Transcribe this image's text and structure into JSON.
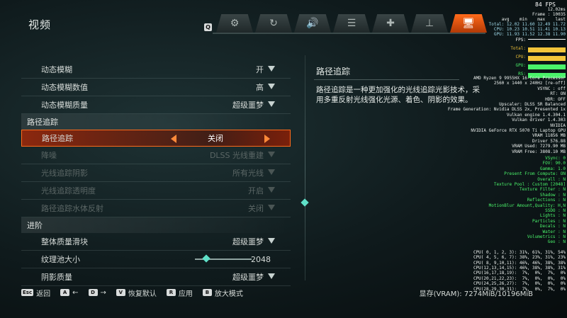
{
  "header": {
    "title": "视频",
    "q_key": "Q",
    "tabs": [
      {
        "icon": "gear-icon",
        "glyph": "⚙"
      },
      {
        "icon": "controller-icon",
        "glyph": "↻"
      },
      {
        "icon": "speaker-icon",
        "glyph": "🔊"
      },
      {
        "icon": "list-icon",
        "glyph": "☰"
      },
      {
        "icon": "crosshair-icon",
        "glyph": "✚"
      },
      {
        "icon": "joystick-icon",
        "glyph": "⊥"
      },
      {
        "icon": "monitor-icon",
        "glyph": "🖥",
        "active": true
      }
    ]
  },
  "settings": {
    "motion_blur": {
      "label": "动态模糊",
      "value": "开"
    },
    "motion_blur_amount": {
      "label": "动态模糊数值",
      "value": "高"
    },
    "motion_blur_quality": {
      "label": "动态模糊质量",
      "value": "超级噩梦"
    },
    "section_pathtracing": "路径追踪",
    "path_tracing": {
      "label": "路径追踪",
      "value": "关闭"
    },
    "denoise": {
      "label": "降噪",
      "value": "DLSS 光线重建"
    },
    "rt_shadows": {
      "label": "光线追踪阴影",
      "value": "所有光线"
    },
    "rt_transparency": {
      "label": "光线追踪透明度",
      "value": "开启"
    },
    "pt_water": {
      "label": "路径追踪水体反射",
      "value": "关闭"
    },
    "section_advanced": "进阶",
    "overall_quality": {
      "label": "整体质量滑块",
      "value": "超级噩梦"
    },
    "texture_pool": {
      "label": "纹理池大小",
      "value": "2048",
      "slider_fraction": 0.2
    },
    "shadow_quality": {
      "label": "阴影质量",
      "value": "超级噩梦"
    }
  },
  "description": {
    "title": "路径追踪",
    "text": "路径追踪是一种更加强化的光线追踪光影技术，采用多重反射光线强化光源、着色、阴影的效果。"
  },
  "bottom_bar": {
    "hints": [
      {
        "key": "Esc",
        "label": "返回"
      },
      {
        "key": "A",
        "label": "←"
      },
      {
        "key": "D",
        "label": "→"
      },
      {
        "key": "V",
        "label": "恢复默认"
      },
      {
        "key": "R",
        "label": "应用"
      },
      {
        "key": "B",
        "label": "放大模式"
      }
    ],
    "vram": "显存(VRAM): 7274MiB/10196MiB"
  },
  "overlay": {
    "fps": "84 FPS",
    "frametime": "12.02ms",
    "frame": "Frame : 10035",
    "table_header": "avg    min    max    last",
    "total": "Total: 12.02 11.60 12.49 11.72",
    "cpu": "CPU: 10.23 10.51 11.41 10.13",
    "gpu": "GPU: 11.93 11.52 12.38 11.90",
    "bar_labels": [
      "FPS:",
      "Total:",
      "CPU:",
      "GPU:",
      "RS:"
    ],
    "bar_colors": [
      "#ffffff",
      "#f2c53a",
      "#f2c53a",
      "#4af26a",
      "#4af26a"
    ],
    "info_lines": [
      "AMD Ryzen 9 9955HX 16-Core Processor",
      "2560 x 1440 x 240Hz [re-off]",
      "VSYNC : off",
      "RT: ON",
      "HDR: OFF",
      "Upscaler: DLSS SR Balanced",
      "Frame Generation: Nvidia DLSS 2x, Presented 1x",
      "Vulkan engine 1.4.304.1",
      "Vulkan driver 1.4.303",
      "NVIDIA",
      "NVIDIA GeForce RTX 5070 Ti Laptop GPU",
      "VRAM 11856 MB",
      "Driver 576.88",
      "VRAM Used: 7279.90 MB",
      "VRAM Free: 3808.10 MB"
    ],
    "green_lines": [
      "VSync: 0",
      "FOV: 90.0",
      "Gamma: 1.0",
      "Present From Compute: ON",
      "Overall : N",
      "Texture Pool : Custom [2048]",
      "Texture Filter : N",
      "Shadow : N",
      "Reflections : N",
      "MotionBlur Amount,Quality: H,N",
      "SSDO : N",
      "Lights : N",
      "Particles : N",
      "Decals : N",
      "Water : N",
      "Volumetrics : N",
      "Geo : N"
    ],
    "cpu_lines": [
      "CPU( 0, 1, 2, 3): 31%, 61%, 31%, 54%",
      "CPU( 4, 5, 6, 7): 38%, 23%, 31%, 23%",
      "CPU( 8, 9,10,11): 46%, 46%, 38%, 38%",
      "CPU(12,13,14,15): 46%, 38%, 38%, 31%",
      "CPU(16,17,18,19):  7%,  0%,  7%,  0%",
      "CPU(20,21,22,23):  7%,  0%,  0%,  0%",
      "CPU(24,25,26,27):  7%,  0%,  0%,  0%",
      "CPU(28,29,30,31):  7%,  0%,  7%,  0%"
    ]
  }
}
